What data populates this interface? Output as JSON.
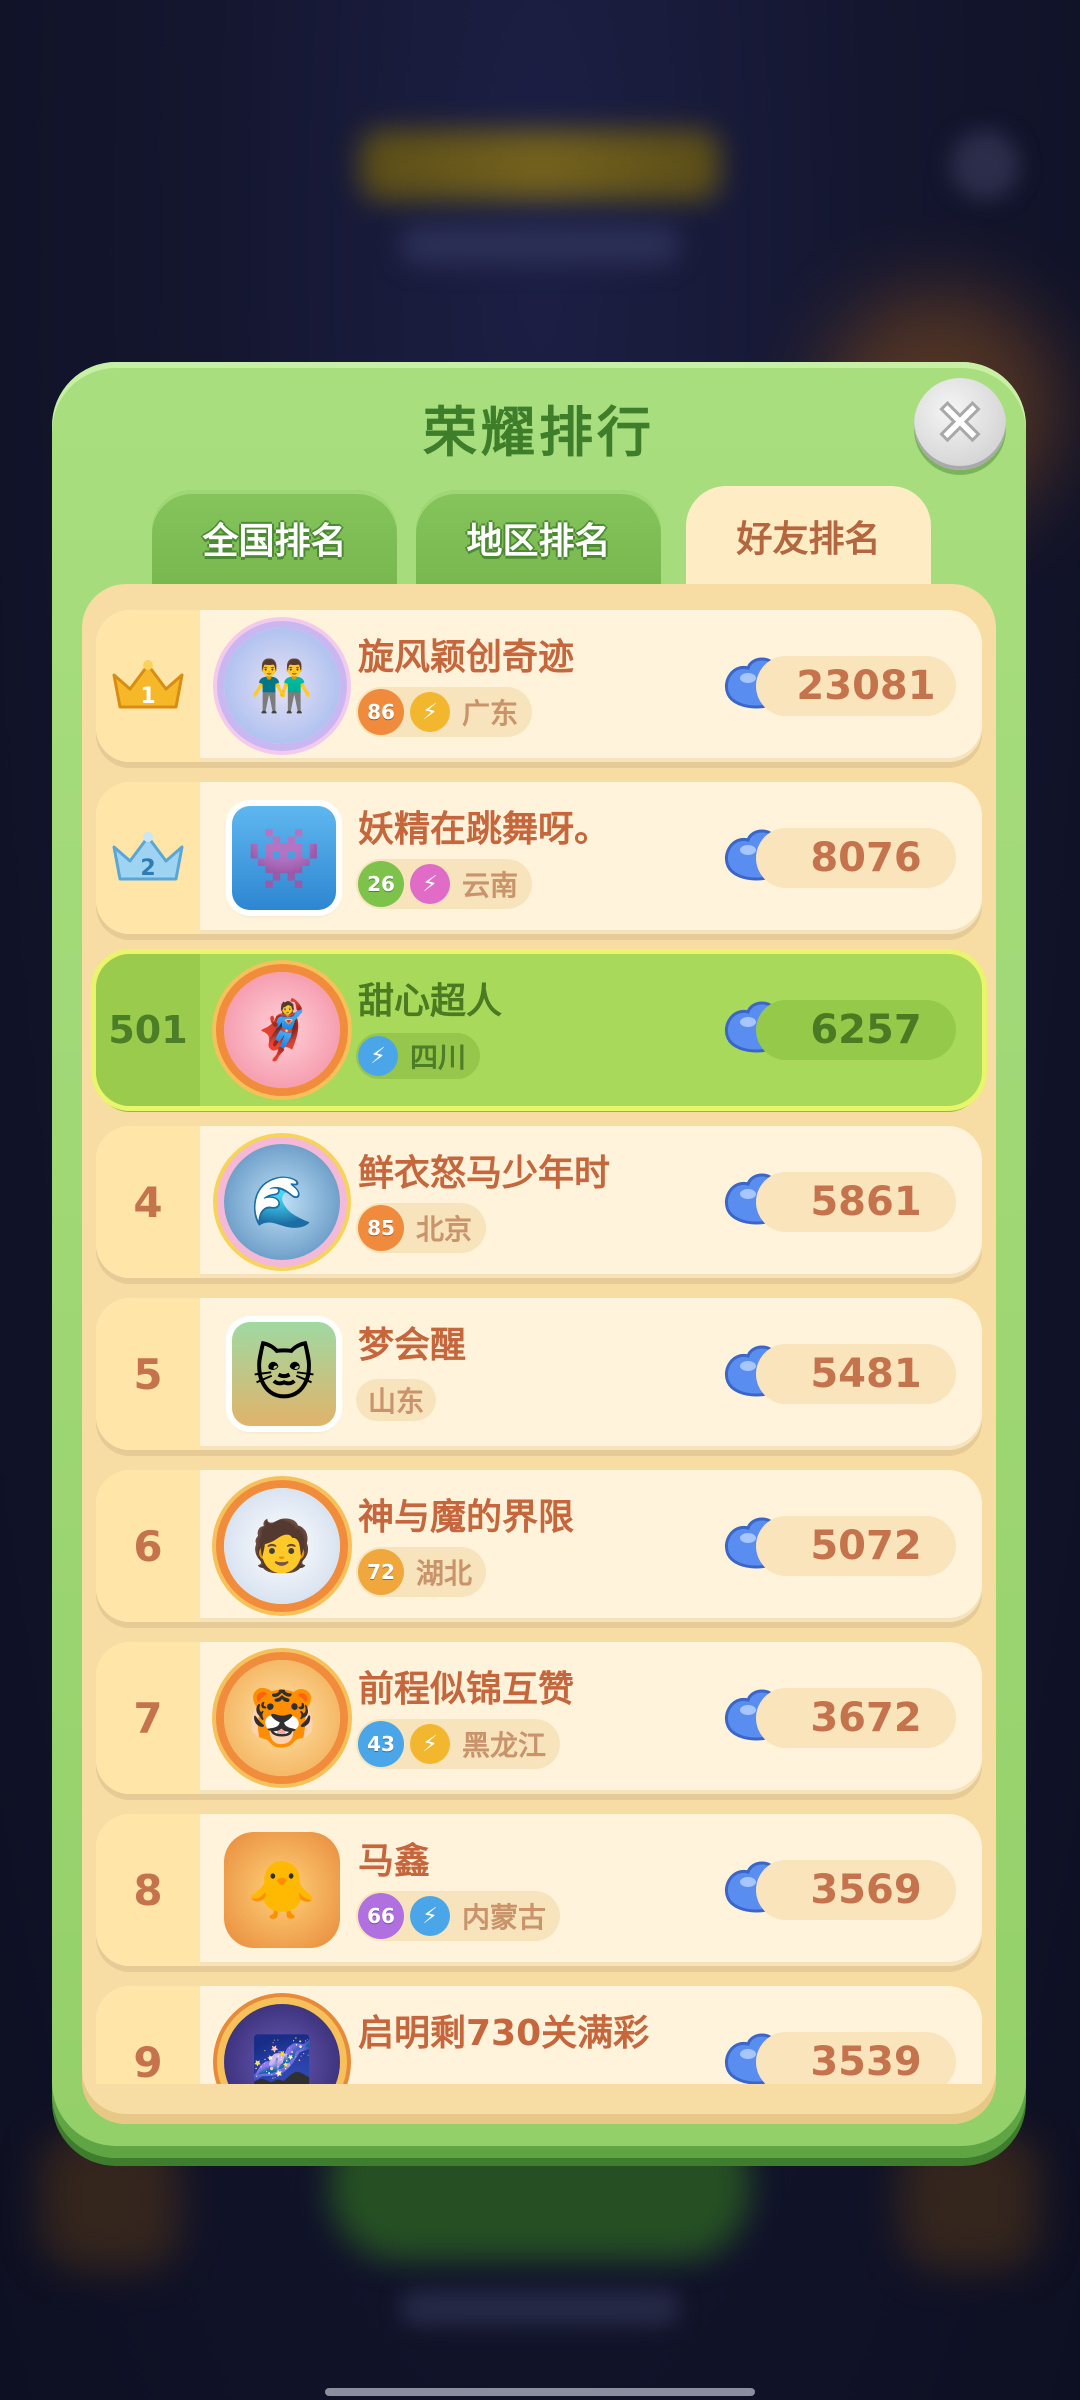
{
  "modal": {
    "title": "荣耀排行",
    "close_icon": "close-icon"
  },
  "tabs": [
    {
      "label": "全国排名",
      "active": false
    },
    {
      "label": "地区排名",
      "active": false
    },
    {
      "label": "好友排名",
      "active": true
    }
  ],
  "rows": [
    {
      "rank": "1",
      "rank_icon": "gold-crown-icon",
      "name": "旋风颖创奇迹",
      "level": "86",
      "level_color": "#f08a3c",
      "vip_color": "#f2b72e",
      "region": "广东",
      "score": "23081"
    },
    {
      "rank": "2",
      "rank_icon": "silver-crown-icon",
      "name": "妖精在跳舞呀。",
      "level": "26",
      "level_color": "#7dc24b",
      "vip_color": "#e06cc8",
      "region": "云南",
      "score": "8076"
    },
    {
      "rank": "501",
      "name": "甜心超人",
      "level": "",
      "vip_color": "#4aa6e8",
      "region": "四川",
      "score": "6257",
      "highlight": true
    },
    {
      "rank": "4",
      "name": "鲜衣怒马少年时",
      "level": "85",
      "level_color": "#f08a3c",
      "region": "北京",
      "score": "5861"
    },
    {
      "rank": "5",
      "name": "梦会醒",
      "region": "山东",
      "score": "5481"
    },
    {
      "rank": "6",
      "name": "神与魔的界限",
      "level": "72",
      "level_color": "#f0a83c",
      "region": "湖北",
      "score": "5072"
    },
    {
      "rank": "7",
      "name": "前程似锦互赞",
      "level": "43",
      "level_color": "#4aa6e8",
      "vip_color": "#f2b72e",
      "region": "黑龙江",
      "score": "3672"
    },
    {
      "rank": "8",
      "name": "马鑫",
      "level": "66",
      "level_color": "#b070e0",
      "vip_color": "#4aa6e8",
      "region": "内蒙古",
      "score": "3569"
    },
    {
      "rank": "9",
      "name": "启明剩730关满彩",
      "score": "3539"
    }
  ],
  "score_icon": "blue-gem-bag-icon",
  "colors": {
    "modal_green": "#94d06a",
    "title_green": "#3e7d2a",
    "row_bg": "#fff4db",
    "highlight_bg": "#a9d95a",
    "rank_text": "#c4734d"
  }
}
